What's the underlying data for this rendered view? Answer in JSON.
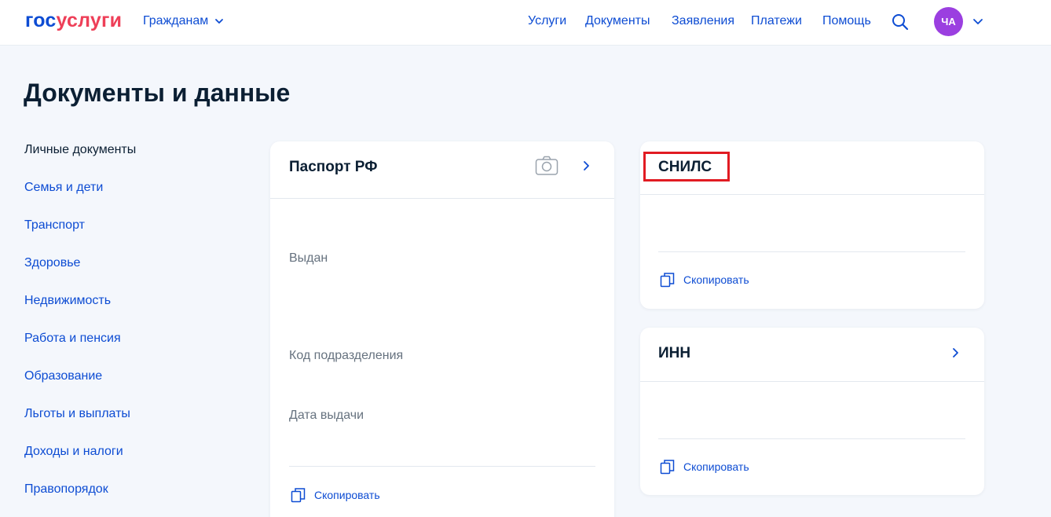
{
  "header": {
    "logo_part1": "гос",
    "logo_part2": "услуги",
    "role_label": "Гражданам",
    "nav": [
      "Услуги",
      "Документы",
      "Заявления",
      "Платежи",
      "Помощь"
    ],
    "avatar_initials": "ЧА"
  },
  "page": {
    "title": "Документы и данные"
  },
  "sidebar": {
    "items": [
      "Личные документы",
      "Семья и дети",
      "Транспорт",
      "Здоровье",
      "Недвижимость",
      "Работа и пенсия",
      "Образование",
      "Льготы и выплаты",
      "Доходы и налоги",
      "Правопорядок"
    ]
  },
  "passport": {
    "title": "Паспорт РФ",
    "issued_label": "Выдан",
    "dept_code_label": "Код подразделения",
    "issue_date_label": "Дата выдачи",
    "copy_label": "Скопировать"
  },
  "snils": {
    "title": "СНИЛС",
    "copy_label": "Скопировать"
  },
  "inn": {
    "title": "ИНН",
    "copy_label": "Скопировать"
  },
  "colors": {
    "accent": "#0d4cd3",
    "logo_red": "#ee3f58",
    "avatar": "#9b3fe0",
    "highlight": "#e11b22"
  }
}
